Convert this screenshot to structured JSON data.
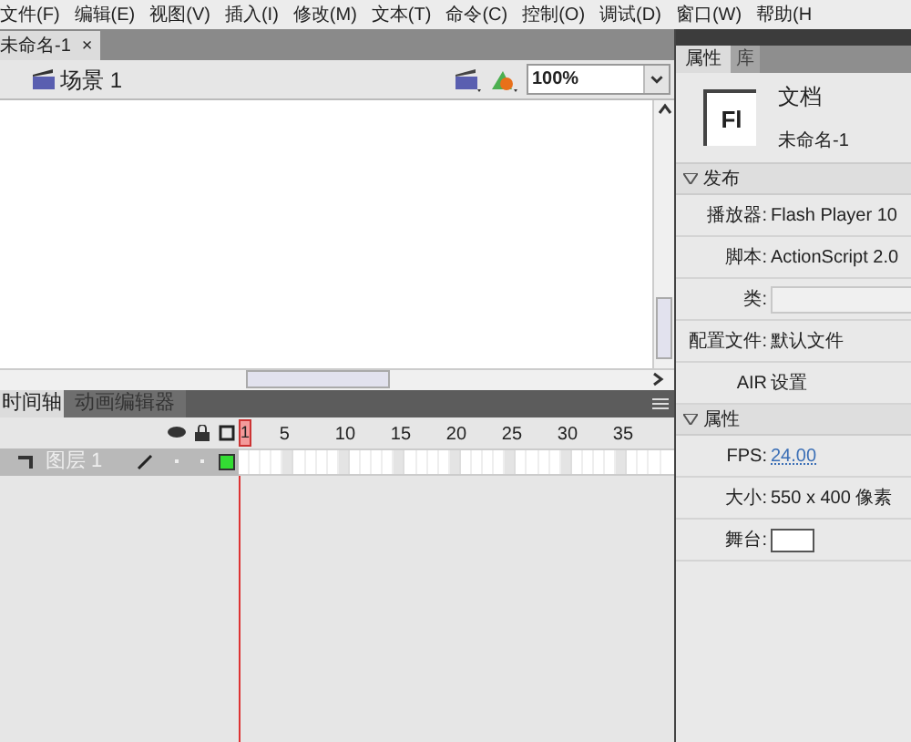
{
  "menu": [
    "文件(F)",
    "编辑(E)",
    "视图(V)",
    "插入(I)",
    "修改(M)",
    "文本(T)",
    "命令(C)",
    "控制(O)",
    "调试(D)",
    "窗口(W)",
    "帮助(H"
  ],
  "document_tab": {
    "title": "未命名-1",
    "close": "×"
  },
  "scene": {
    "label": "场景 1",
    "zoom": "100%"
  },
  "timeline": {
    "tabs": [
      {
        "label": "时间轴",
        "selected": true
      },
      {
        "label": "动画编辑器",
        "selected": false
      }
    ],
    "frame_numbers": [
      "1",
      "5",
      "10",
      "15",
      "20",
      "25",
      "30",
      "35"
    ],
    "layers": [
      {
        "name": "图层 1",
        "selected": true
      }
    ]
  },
  "properties": {
    "tabs": [
      {
        "label": "属性",
        "selected": true
      },
      {
        "label": "库",
        "selected": false
      }
    ],
    "document": {
      "logo": "Fl",
      "type": "文档",
      "name": "未命名-1"
    },
    "sections": [
      {
        "title": "发布",
        "expanded": true,
        "rows": [
          {
            "kind": "text",
            "label": "播放器:",
            "value": "Flash Player 10"
          },
          {
            "kind": "text",
            "label": "脚本:",
            "value": "ActionScript 2.0"
          },
          {
            "kind": "field",
            "label": "类:"
          },
          {
            "kind": "text",
            "label": "配置文件:",
            "value": "默认文件"
          },
          {
            "kind": "text",
            "label": "AIR",
            "value": "设置"
          }
        ]
      },
      {
        "title": "属性",
        "expanded": true,
        "rows": [
          {
            "kind": "link",
            "label": "FPS:",
            "value": "24.00"
          },
          {
            "kind": "text",
            "label": "大小:",
            "value": "550 x 400 像素"
          },
          {
            "kind": "swatch",
            "label": "舞台:"
          }
        ]
      }
    ]
  }
}
